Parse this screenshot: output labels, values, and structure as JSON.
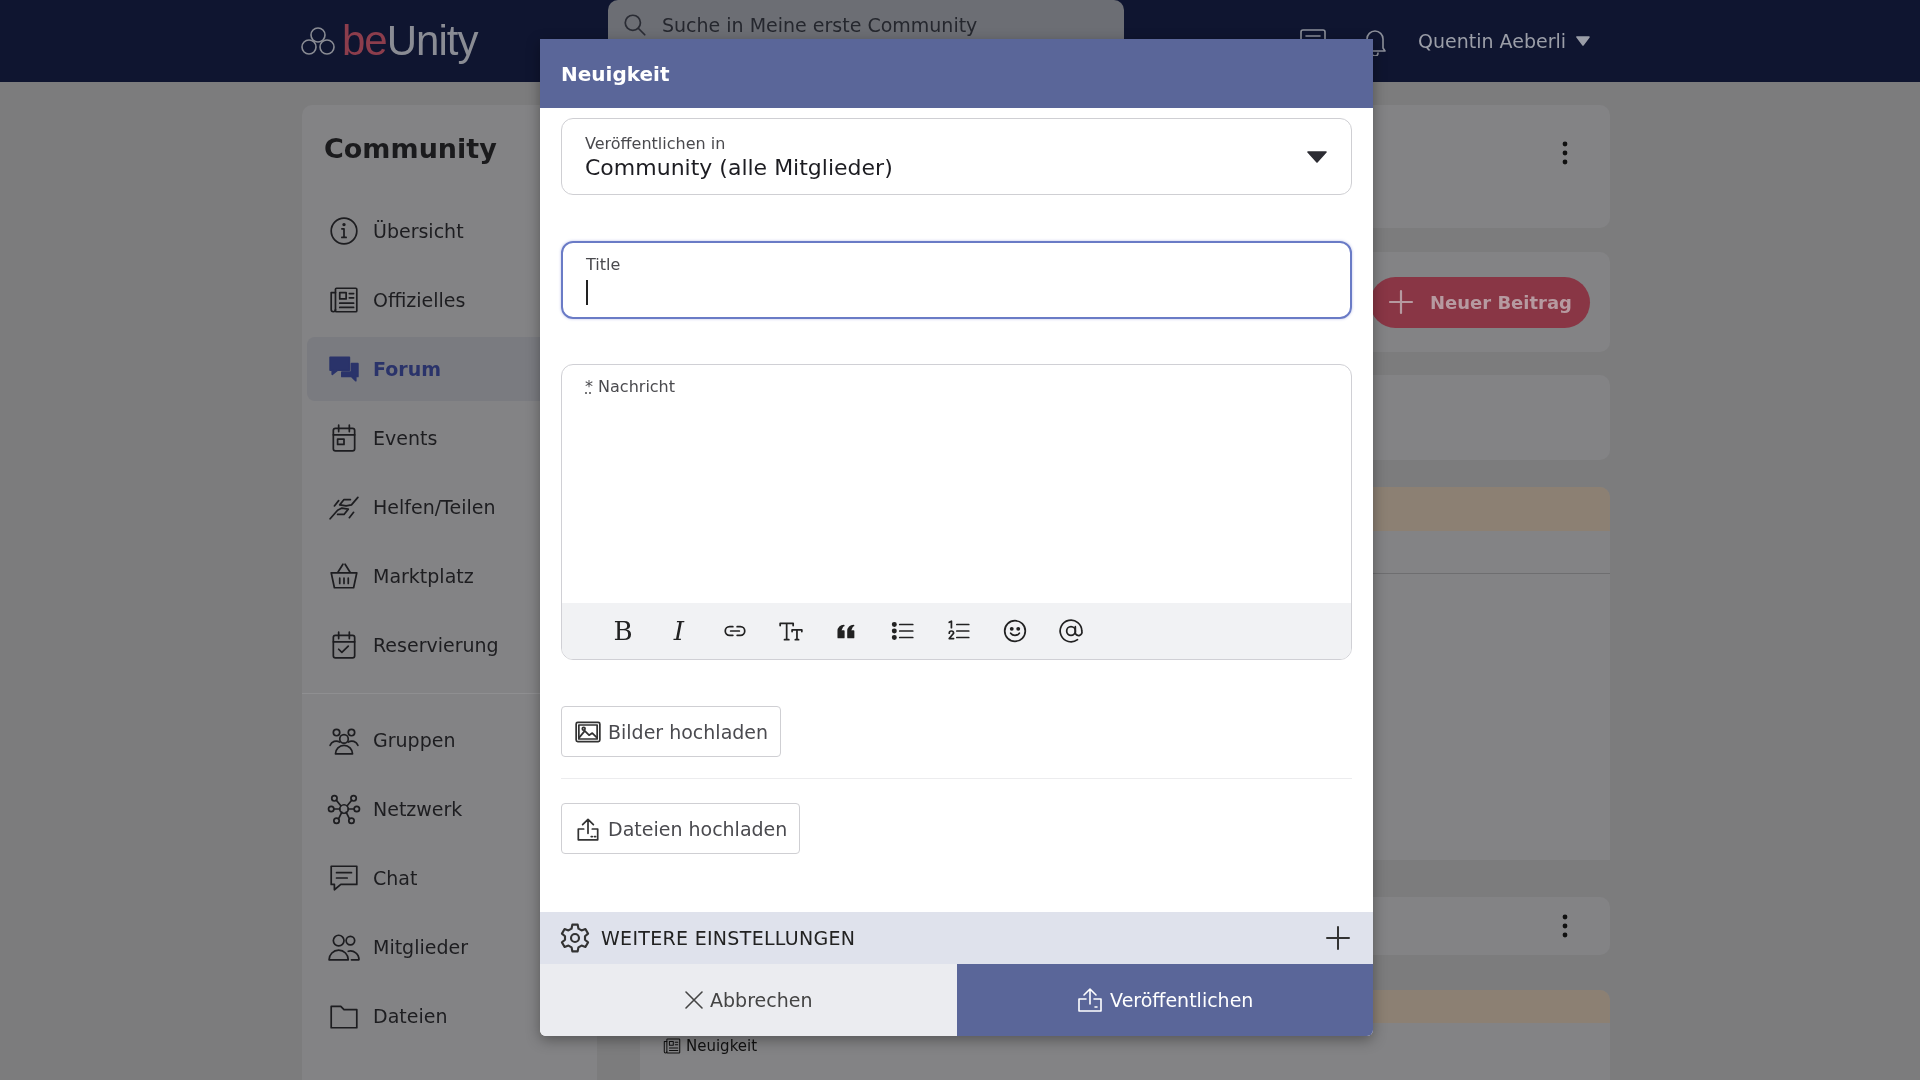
{
  "header": {
    "logo": {
      "prefix": "be",
      "suffix": "Unity"
    },
    "search": {
      "placeholder": "Suche in Meine erste Community"
    },
    "user": "Quentin Aeberli"
  },
  "sidebar": {
    "title": "Community",
    "groups": [
      [
        {
          "label": "Übersicht",
          "selected": false
        },
        {
          "label": "Offizielles",
          "selected": false
        },
        {
          "label": "Forum",
          "selected": true
        },
        {
          "label": "Events",
          "selected": false
        },
        {
          "label": "Helfen/Teilen",
          "selected": false
        },
        {
          "label": "Marktplatz",
          "selected": false
        },
        {
          "label": "Reservierung",
          "selected": false
        }
      ],
      [
        {
          "label": "Gruppen",
          "selected": false
        },
        {
          "label": "Netzwerk",
          "selected": false
        },
        {
          "label": "Chat",
          "selected": false
        },
        {
          "label": "Mitglieder",
          "selected": false
        },
        {
          "label": "Dateien",
          "selected": false
        }
      ]
    ]
  },
  "background": {
    "new_post_button": "Neuer Beitrag",
    "post_tag": "Neuigkeit"
  },
  "modal": {
    "title": "Neuigkeit",
    "select": {
      "label": "Veröffentlichen in",
      "value": "Community (alle Mitglieder)"
    },
    "title_field": {
      "label": "Title",
      "focused": true
    },
    "message": {
      "required_mark": "*",
      "label": "Nachricht",
      "tools": [
        {
          "kind": "bold",
          "glyph": "B"
        },
        {
          "kind": "italic",
          "glyph": "I"
        },
        {
          "kind": "link"
        },
        {
          "kind": "heading"
        },
        {
          "kind": "quote"
        },
        {
          "kind": "bullets"
        },
        {
          "kind": "numbers"
        },
        {
          "kind": "emoji"
        },
        {
          "kind": "mention"
        }
      ]
    },
    "uploads": [
      {
        "kind": "image",
        "label": "Bilder hochladen"
      },
      {
        "kind": "file",
        "label": "Dateien hochladen"
      }
    ],
    "settings": {
      "label": "WEITERE EINSTELLUNGEN",
      "expanded": false
    },
    "cancel": "Abbrechen",
    "publish": "Veröffentlichen"
  }
}
